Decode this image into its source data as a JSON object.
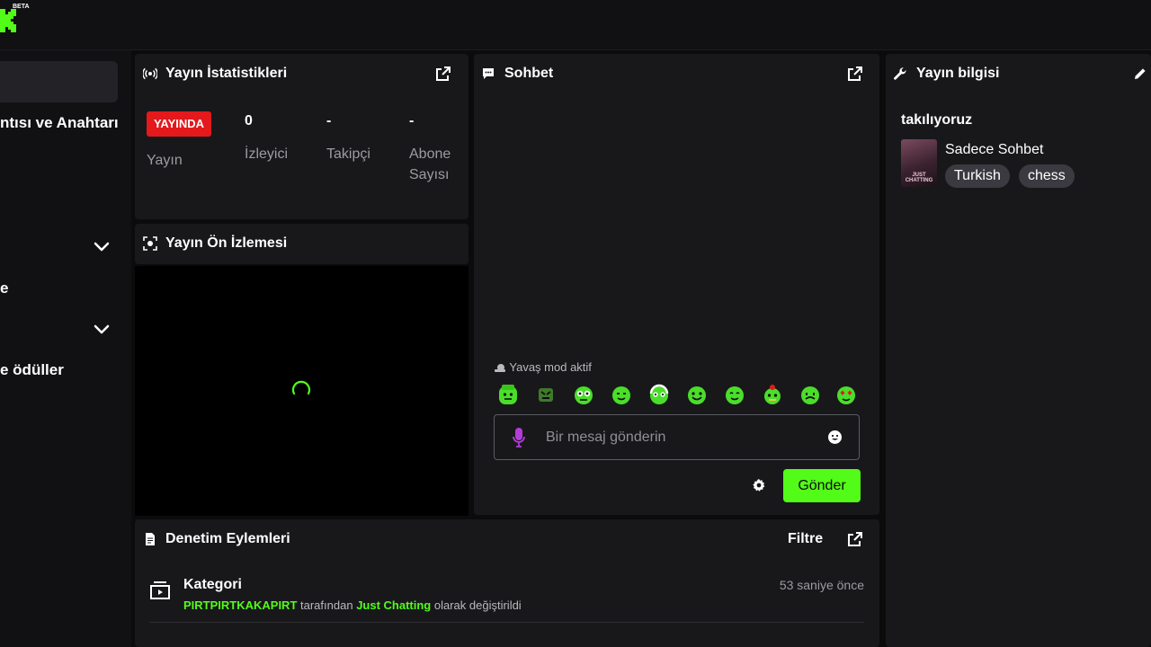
{
  "header": {
    "beta_label": "BETA"
  },
  "sidebar": {
    "items": [
      {
        "label": "ntısı ve Anahtarı"
      },
      {
        "label": "e"
      },
      {
        "label": "e ödüller"
      }
    ]
  },
  "stats_panel": {
    "title": "Yayın İstatistikleri",
    "live_badge": "YAYINDA",
    "stream_label": "Yayın",
    "stats": [
      {
        "value": "0",
        "label": "İzleyici"
      },
      {
        "value": "-",
        "label": "Takipçi"
      },
      {
        "value": "-",
        "label_line1": "Abone",
        "label_line2": "Sayısı"
      }
    ]
  },
  "preview_panel": {
    "title": "Yayın Ön İzlemesi"
  },
  "chat_panel": {
    "title": "Sohbet",
    "slow_mode": "Yavaş mod aktif",
    "input_placeholder": "Bir mesaj gönderin",
    "send_label": "Gönder",
    "emotes": [
      "emote-1",
      "emote-2",
      "emote-3",
      "emote-4",
      "emote-5",
      "emote-6",
      "emote-7",
      "emote-8",
      "emote-9",
      "emote-10"
    ]
  },
  "info_panel": {
    "title": "Yayın bilgisi",
    "stream_title": "takılıyoruz",
    "category": "Sadece Sohbet",
    "thumb_text": "JUST CHATTING",
    "tags": [
      "Turkish",
      "chess"
    ]
  },
  "moderation_panel": {
    "title": "Denetim Eylemleri",
    "filter_label": "Filtre",
    "entry": {
      "title": "Kategori",
      "time": "53 saniye önce",
      "user": "PIRTPIRTKAKAPIRT",
      "text_1": "tarafından",
      "category": "Just Chatting",
      "text_2": "olarak değiştirildi"
    }
  },
  "colors": {
    "accent": "#53fc18",
    "live": "#e3191c",
    "panel": "#18181b",
    "background": "#0b0b0c"
  }
}
